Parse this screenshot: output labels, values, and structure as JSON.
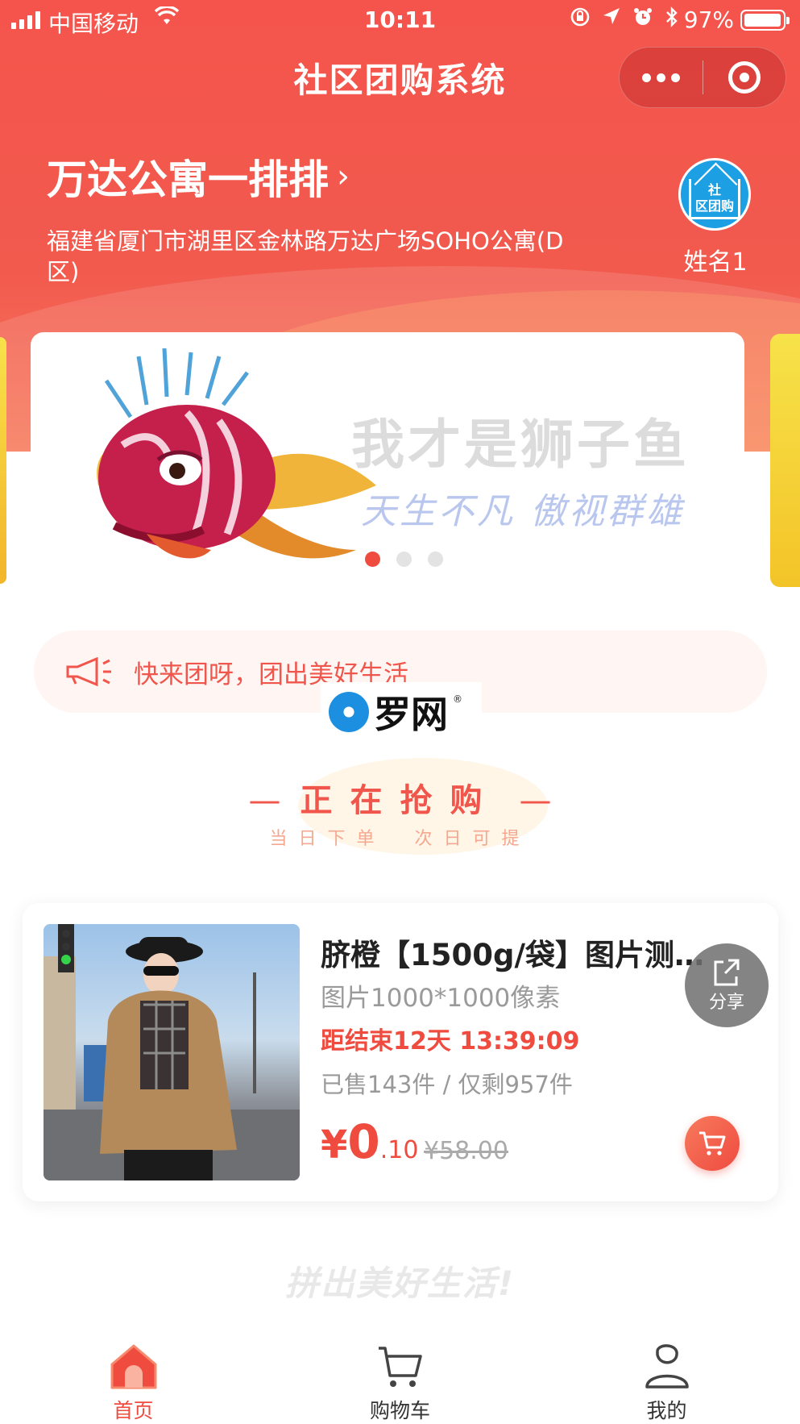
{
  "status_bar": {
    "carrier": "中国移动",
    "time": "10:11",
    "battery": "97%",
    "battery_level": 0.97
  },
  "nav": {
    "title": "社区团购系统"
  },
  "community": {
    "name": "万达公寓一排排",
    "address": "福建省厦门市湖里区金林路万达广场SOHO公寓(D区)",
    "avatar_text_line1": "社",
    "avatar_text_line2": "区团购",
    "user_name": "姓名1"
  },
  "banner": {
    "headline": "我才是狮子鱼",
    "tagline": "天生不凡 傲视群雄",
    "slide_count": 3,
    "active_slide": 1
  },
  "notice": {
    "text": "快来团呀，团出美好生活"
  },
  "watermark": {
    "text": "罗网",
    "reg": "®"
  },
  "section": {
    "title_chars": [
      "正",
      "在",
      "抢",
      "购"
    ],
    "subtitle_left": "当日下单",
    "subtitle_right": "次日可提"
  },
  "product": {
    "name": "脐橙【1500g/袋】图片测试...",
    "desc": "图片1000*1000像素",
    "countdown_prefix": "距结束",
    "countdown": "12天 13:39:09",
    "sold": "已售143件 / 仅剩957件",
    "price_currency": "¥",
    "price_int": "0",
    "price_dec": ".10",
    "original_price": "¥58.00"
  },
  "share": {
    "label": "分享"
  },
  "slogan": "拼出美好生活!",
  "tabs": [
    {
      "label": "首页",
      "icon": "home-icon",
      "active": true
    },
    {
      "label": "购物车",
      "icon": "cart-icon",
      "active": false
    },
    {
      "label": "我的",
      "icon": "user-icon",
      "active": false
    }
  ],
  "colors": {
    "primary": "#ef4b3f",
    "header": "#f4544c",
    "accent_yellow": "#f7e24a"
  }
}
